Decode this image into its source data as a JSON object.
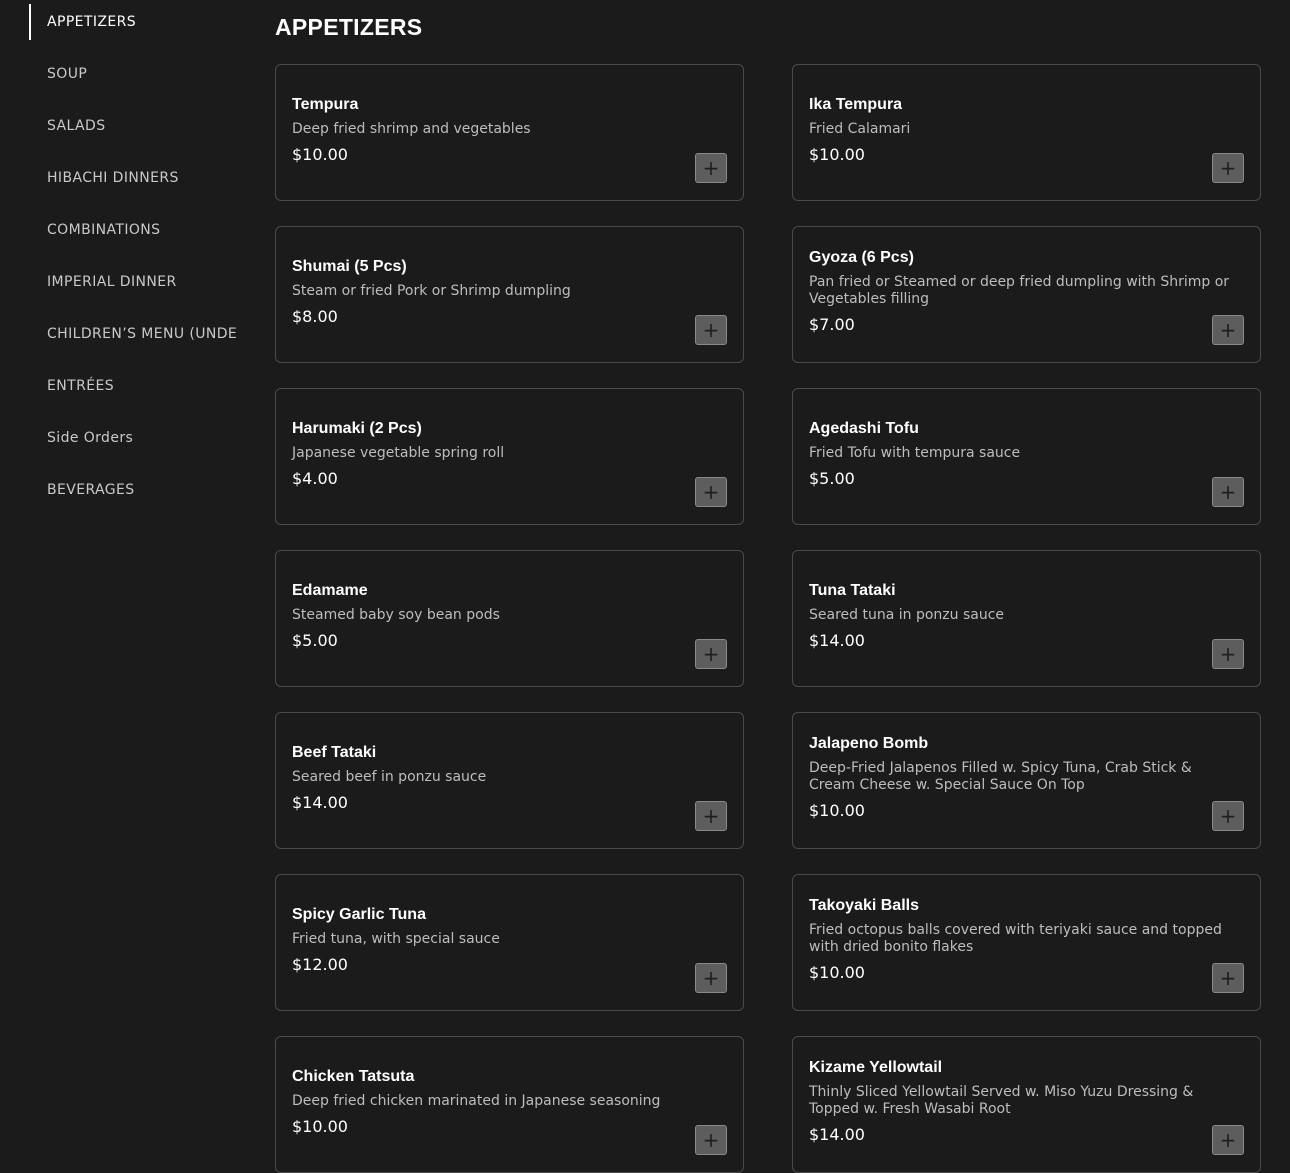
{
  "sidebar": {
    "items": [
      {
        "label": "APPETIZERS",
        "active": true
      },
      {
        "label": "SOUP"
      },
      {
        "label": "SALADS"
      },
      {
        "label": "HIBACHI DINNERS"
      },
      {
        "label": "COMBINATIONS"
      },
      {
        "label": "IMPERIAL DINNER"
      },
      {
        "label": "CHILDREN’S MENU (UNDE"
      },
      {
        "label": "ENTRÉES"
      },
      {
        "label": "Side Orders"
      },
      {
        "label": "BEVERAGES"
      }
    ]
  },
  "main": {
    "title": "APPETIZERS",
    "add_icon": "plus-icon",
    "add_symbol": "+",
    "items": [
      {
        "name": "Tempura",
        "desc": "Deep fried shrimp and vegetables",
        "price": "$10.00"
      },
      {
        "name": "Ika Tempura",
        "desc": "Fried Calamari",
        "price": "$10.00"
      },
      {
        "name": "Shumai (5 Pcs)",
        "desc": "Steam or fried Pork or Shrimp dumpling",
        "price": "$8.00"
      },
      {
        "name": "Gyoza (6 Pcs)",
        "desc": "Pan fried or Steamed or deep fried dumpling with Shrimp or Vegetables filling",
        "price": "$7.00"
      },
      {
        "name": "Harumaki (2 Pcs)",
        "desc": "Japanese vegetable spring roll",
        "price": "$4.00"
      },
      {
        "name": "Agedashi Tofu",
        "desc": "Fried Tofu with tempura sauce",
        "price": "$5.00"
      },
      {
        "name": "Edamame",
        "desc": "Steamed baby soy bean pods",
        "price": "$5.00"
      },
      {
        "name": "Tuna Tataki",
        "desc": "Seared tuna in ponzu sauce",
        "price": "$14.00"
      },
      {
        "name": "Beef Tataki",
        "desc": "Seared beef in ponzu sauce",
        "price": "$14.00"
      },
      {
        "name": "Jalapeno Bomb",
        "desc": "Deep-Fried Jalapenos Filled w. Spicy Tuna, Crab Stick & Cream Cheese w. Special Sauce On Top",
        "price": "$10.00"
      },
      {
        "name": "Spicy Garlic Tuna",
        "desc": "Fried tuna, with special sauce",
        "price": "$12.00"
      },
      {
        "name": "Takoyaki Balls",
        "desc": "Fried octopus balls covered with teriyaki sauce and topped with dried bonito flakes",
        "price": "$10.00"
      },
      {
        "name": "Chicken Tatsuta",
        "desc": "Deep fried chicken marinated in Japanese seasoning",
        "price": "$10.00"
      },
      {
        "name": "Kizame Yellowtail",
        "desc": "Thinly Sliced Yellowtail Served w. Miso Yuzu Dressing & Topped w. Fresh Wasabi Root",
        "price": "$14.00"
      }
    ]
  },
  "colors": {
    "background": "#1c1b1b",
    "card_border": "#4a4a4a",
    "button_bg": "#5d5d5d"
  }
}
